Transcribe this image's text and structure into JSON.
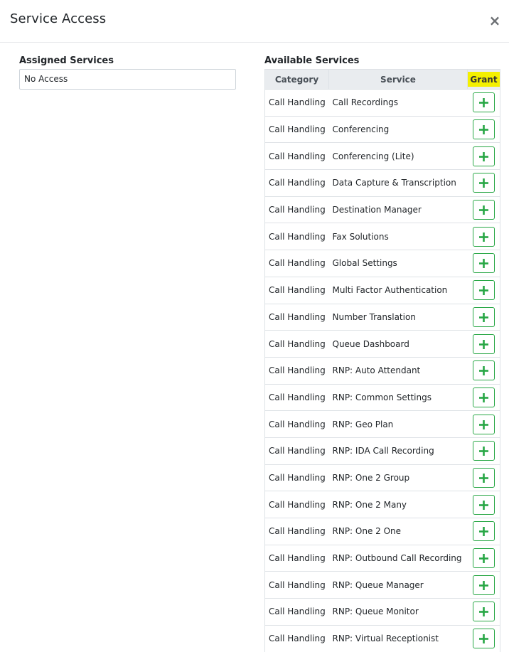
{
  "modal": {
    "title": "Service Access",
    "close_label": "×"
  },
  "assigned": {
    "title": "Assigned Services",
    "value": "No Access"
  },
  "available": {
    "title": "Available Services",
    "headers": {
      "category": "Category",
      "service": "Service",
      "grant": "Grant"
    },
    "rows": [
      {
        "category": "Call Handling",
        "service": "Call Recordings"
      },
      {
        "category": "Call Handling",
        "service": "Conferencing"
      },
      {
        "category": "Call Handling",
        "service": "Conferencing (Lite)"
      },
      {
        "category": "Call Handling",
        "service": "Data Capture & Transcription"
      },
      {
        "category": "Call Handling",
        "service": "Destination Manager"
      },
      {
        "category": "Call Handling",
        "service": "Fax Solutions"
      },
      {
        "category": "Call Handling",
        "service": "Global Settings"
      },
      {
        "category": "Call Handling",
        "service": "Multi Factor Authentication"
      },
      {
        "category": "Call Handling",
        "service": "Number Translation"
      },
      {
        "category": "Call Handling",
        "service": "Queue Dashboard"
      },
      {
        "category": "Call Handling",
        "service": "RNP: Auto Attendant"
      },
      {
        "category": "Call Handling",
        "service": "RNP: Common Settings"
      },
      {
        "category": "Call Handling",
        "service": "RNP: Geo Plan"
      },
      {
        "category": "Call Handling",
        "service": "RNP: IDA Call Recording"
      },
      {
        "category": "Call Handling",
        "service": "RNP: One 2 Group"
      },
      {
        "category": "Call Handling",
        "service": "RNP: One 2 Many"
      },
      {
        "category": "Call Handling",
        "service": "RNP: One 2 One"
      },
      {
        "category": "Call Handling",
        "service": "RNP: Outbound Call Recording"
      },
      {
        "category": "Call Handling",
        "service": "RNP: Queue Manager"
      },
      {
        "category": "Call Handling",
        "service": "RNP: Queue Monitor"
      },
      {
        "category": "Call Handling",
        "service": "RNP: Virtual Receptionist"
      }
    ]
  },
  "colors": {
    "grant_button_border": "#28a745",
    "grant_highlight": "#f4f000",
    "header_bg": "#e9ecef"
  },
  "icons": {
    "grant": "plus-icon",
    "close": "close-icon"
  }
}
